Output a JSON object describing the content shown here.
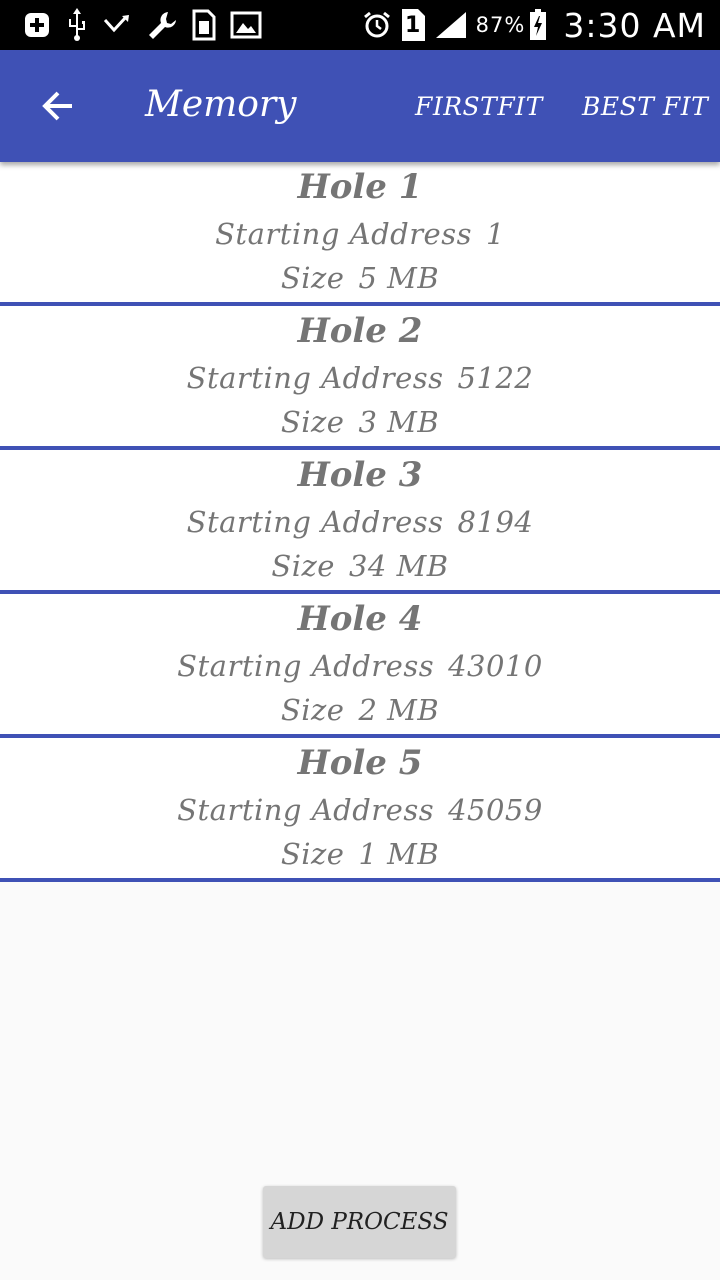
{
  "status_bar": {
    "battery": "87%",
    "time": "3:30 AM",
    "sim_slot": "1",
    "icons": [
      "plus-icon",
      "usb-icon",
      "missed-call-icon",
      "wrench-icon",
      "sim-icon",
      "image-icon",
      "alarm-icon",
      "sim-slot-icon",
      "signal-icon",
      "battery-charging-icon"
    ]
  },
  "toolbar": {
    "title": "Memory",
    "back_icon": "arrow-back-icon",
    "actions": [
      "FIRSTFIT",
      "BEST FIT"
    ],
    "color": "#3f51b5"
  },
  "holes": [
    {
      "title": "Hole 1",
      "address_label": "Starting Address",
      "address": "1",
      "size_label": "Size",
      "size": "5 MB"
    },
    {
      "title": "Hole 2",
      "address_label": "Starting Address",
      "address": "5122",
      "size_label": "Size",
      "size": "3 MB"
    },
    {
      "title": "Hole 3",
      "address_label": "Starting Address",
      "address": "8194",
      "size_label": "Size",
      "size": "34 MB"
    },
    {
      "title": "Hole 4",
      "address_label": "Starting Address",
      "address": "43010",
      "size_label": "Size",
      "size": "2 MB"
    },
    {
      "title": "Hole 5",
      "address_label": "Starting Address",
      "address": "45059",
      "size_label": "Size",
      "size": "1 MB"
    }
  ],
  "add_button": {
    "label": "ADD PROCESS"
  },
  "colors": {
    "accent": "#3f51b5",
    "text": "#757575",
    "background": "#fafafa"
  }
}
